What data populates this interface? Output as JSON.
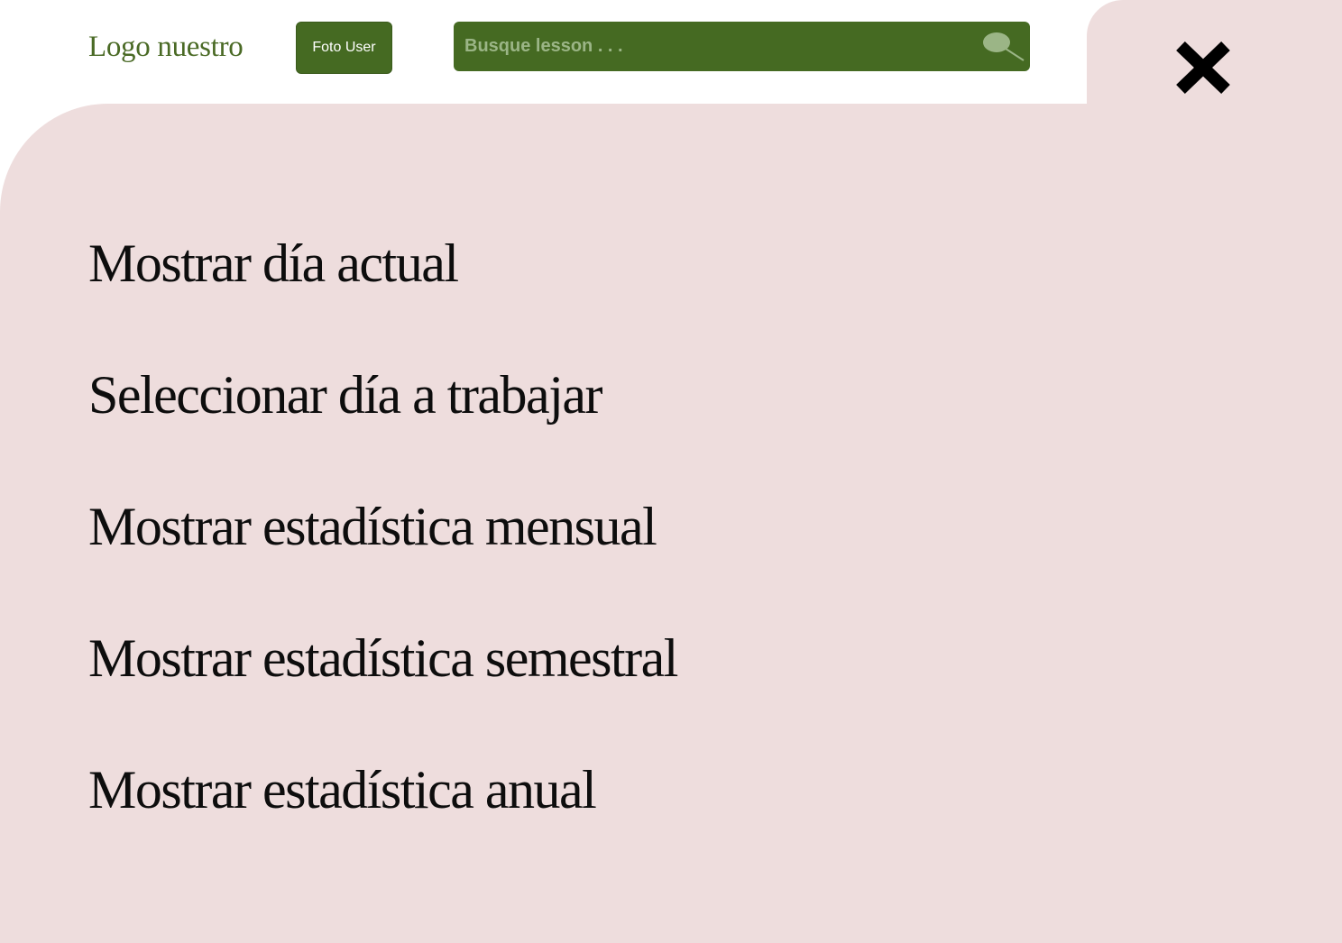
{
  "header": {
    "logo_text": "Logo nuestro",
    "user_photo_label": "Foto User",
    "search": {
      "placeholder": "Busque lesson . . .",
      "icon": "magnifier-icon"
    },
    "close_icon": "close-icon"
  },
  "menu": {
    "items": [
      {
        "label": "Mostrar día actual"
      },
      {
        "label": "Seleccionar día a trabajar"
      },
      {
        "label": "Mostrar estadística mensual"
      },
      {
        "label": "Mostrar estadística semestral"
      },
      {
        "label": "Mostrar estadística anual"
      }
    ]
  },
  "colors": {
    "brand_green": "#456a22",
    "logo_green": "#4a6a25",
    "panel_pink": "#eedddd",
    "text_dark": "#0d0d0d"
  }
}
